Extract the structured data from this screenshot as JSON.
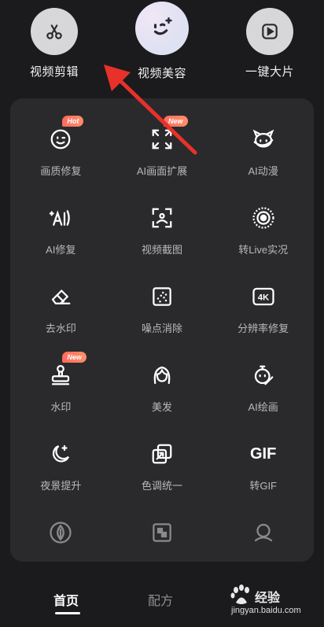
{
  "shortcuts": [
    {
      "label": "视频剪辑",
      "icon": "scissors-icon"
    },
    {
      "label": "视频美容",
      "icon": "beauty-face-icon"
    },
    {
      "label": "一键大片",
      "icon": "play-square-icon"
    }
  ],
  "tools": [
    {
      "label": "画质修复",
      "icon": "face-wink-icon",
      "badge": "Hot"
    },
    {
      "label": "AI画面扩展",
      "icon": "expand-arrows-icon",
      "badge": "New"
    },
    {
      "label": "AI动漫",
      "icon": "anime-face-icon",
      "badge": ""
    },
    {
      "label": "AI修复",
      "icon": "ai-sparkle-icon",
      "badge": ""
    },
    {
      "label": "视频截图",
      "icon": "screenshot-icon",
      "badge": ""
    },
    {
      "label": "转Live实况",
      "icon": "live-target-icon",
      "badge": ""
    },
    {
      "label": "去水印",
      "icon": "eraser-icon",
      "badge": ""
    },
    {
      "label": "噪点消除",
      "icon": "noise-square-icon",
      "badge": ""
    },
    {
      "label": "分辨率修复",
      "icon": "4k-icon",
      "badge": ""
    },
    {
      "label": "水印",
      "icon": "stamp-icon",
      "badge": "New"
    },
    {
      "label": "美发",
      "icon": "hair-icon",
      "badge": ""
    },
    {
      "label": "AI绘画",
      "icon": "paint-face-icon",
      "badge": ""
    },
    {
      "label": "夜景提升",
      "icon": "moon-stars-icon",
      "badge": ""
    },
    {
      "label": "色调统一",
      "icon": "color-tone-icon",
      "badge": ""
    },
    {
      "label": "转GIF",
      "icon": "gif-icon",
      "badge": ""
    }
  ],
  "four_k_text": "4K",
  "gif_text": "GIF",
  "nav": [
    {
      "label": "首页"
    },
    {
      "label": "配方"
    }
  ],
  "watermark": {
    "brand": "经验",
    "url": "jingyan.baidu.com"
  },
  "colors": {
    "background": "#1b1b1d",
    "panel": "#2a2a2d",
    "badge": "#ff6f5e",
    "arrow": "#e8312a"
  }
}
